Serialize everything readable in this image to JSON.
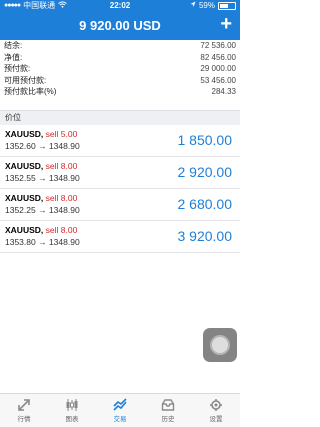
{
  "status_bar": {
    "carrier": "中国联通",
    "time": "22:02",
    "battery": "59%"
  },
  "header": {
    "title": "9 920.00 USD",
    "add_label": "+"
  },
  "summary": [
    {
      "label": "结余:",
      "value": "72 536.00"
    },
    {
      "label": "净值:",
      "value": "82 456.00"
    },
    {
      "label": "预付款:",
      "value": "29 000.00"
    },
    {
      "label": "可用预付款:",
      "value": "53 456.00"
    },
    {
      "label": "预付款比率(%)",
      "value": "284.33"
    }
  ],
  "section_label": "价位",
  "positions": [
    {
      "symbol": "XAUUSD,",
      "side": "sell 5.00",
      "prices": "1352.60 → 1348.90",
      "profit": "1 850.00"
    },
    {
      "symbol": "XAUUSD,",
      "side": "sell 8.00",
      "prices": "1352.55 → 1348.90",
      "profit": "2 920.00"
    },
    {
      "symbol": "XAUUSD,",
      "side": "sell 8.00",
      "prices": "1352.25 → 1348.90",
      "profit": "2 680.00"
    },
    {
      "symbol": "XAUUSD,",
      "side": "sell 8.00",
      "prices": "1353.80 → 1348.90",
      "profit": "3 920.00"
    }
  ],
  "tabs": [
    {
      "label": "行情",
      "icon": "quotes-icon"
    },
    {
      "label": "图表",
      "icon": "chart-icon"
    },
    {
      "label": "交易",
      "icon": "trade-icon"
    },
    {
      "label": "历史",
      "icon": "history-icon"
    },
    {
      "label": "设置",
      "icon": "settings-icon"
    }
  ],
  "colors": {
    "accent": "#1e7fd8",
    "sell": "#d02a2a"
  }
}
